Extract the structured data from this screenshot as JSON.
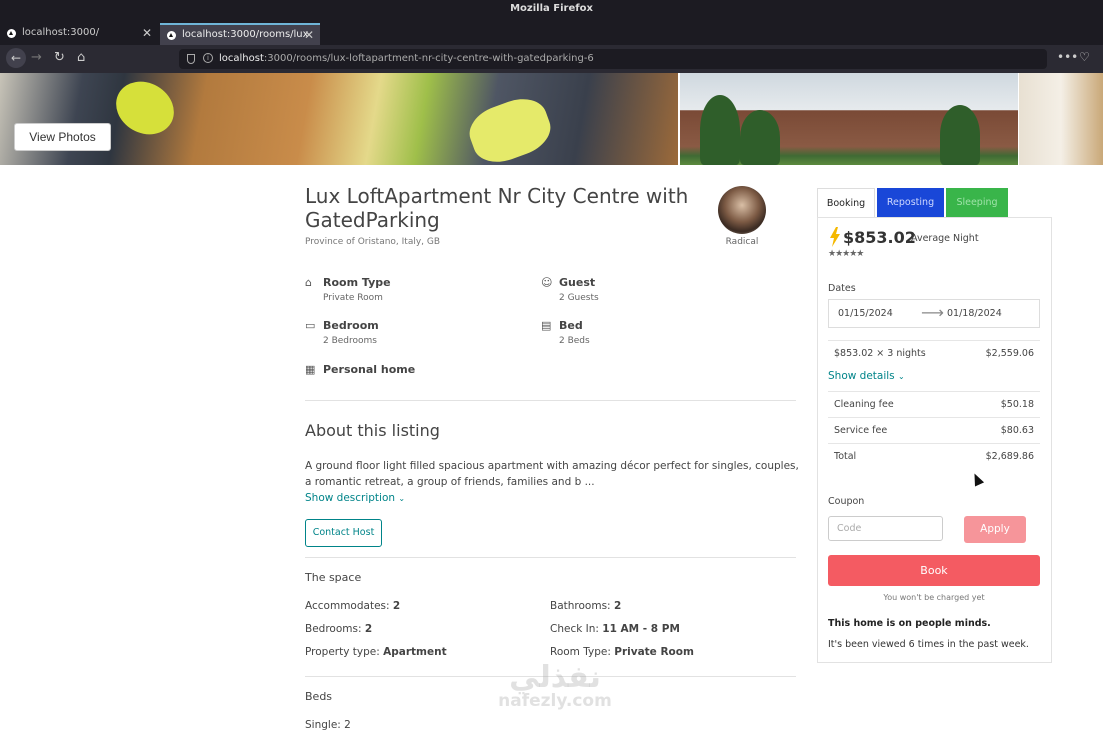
{
  "window": {
    "title": "Mozilla Firefox"
  },
  "tabs": [
    {
      "label": "localhost:3000/"
    },
    {
      "label": "localhost:3000/rooms/lux"
    }
  ],
  "url": {
    "host": "localhost",
    "rest": ":3000/rooms/lux-loftapartment-nr-city-centre-with-gatedparking-6"
  },
  "hero": {
    "view_photos": "View Photos"
  },
  "listing": {
    "title": "Lux LoftApartment Nr City Centre with GatedParking",
    "location": "Province of Oristano, Italy, GB",
    "host_name": "Radical",
    "features": [
      {
        "icon": "house-icon",
        "label": "Room Type",
        "value": "Private Room"
      },
      {
        "icon": "user-icon",
        "label": "Guest",
        "value": "2 Guests"
      },
      {
        "icon": "couch-icon",
        "label": "Bedroom",
        "value": "2 Bedrooms"
      },
      {
        "icon": "bed-icon",
        "label": "Bed",
        "value": "2 Beds"
      },
      {
        "icon": "building-icon",
        "label": "Personal home",
        "value": ""
      }
    ],
    "about_title": "About this listing",
    "description": "A ground floor light filled spacious apartment with amazing décor perfect for singles, couples, a romantic retreat, a group of friends, families and b ...",
    "show_description": "Show description",
    "contact_host": "Contact Host",
    "space_title": "The space",
    "space": [
      {
        "key": "Accommodates:",
        "value": "2"
      },
      {
        "key": "Bathrooms:",
        "value": "2"
      },
      {
        "key": "Bedrooms:",
        "value": "2"
      },
      {
        "key": "Check In:",
        "value": "11 AM - 8 PM"
      },
      {
        "key": "Property type:",
        "value": "Apartment"
      },
      {
        "key": "Room Type:",
        "value": "Private Room"
      }
    ],
    "beds_title": "Beds",
    "beds_first": "Single: 2"
  },
  "booking": {
    "tabs": [
      "Booking",
      "Reposting",
      "Sleeping"
    ],
    "price": "$853.02",
    "price_unit": "Average Night",
    "stars": "★★★★★",
    "dates_label": "Dates",
    "check_in": "01/15/2024",
    "check_out": "01/18/2024",
    "nights_label": "$853.02 × 3 nights",
    "nights_total": "$2,559.06",
    "show_details": "Show details",
    "fees": [
      {
        "label": "Cleaning fee",
        "value": "$50.18"
      },
      {
        "label": "Service fee",
        "value": "$80.63"
      },
      {
        "label": "Total",
        "value": "$2,689.86"
      }
    ],
    "coupon_label": "Coupon",
    "coupon_placeholder": "Code",
    "apply": "Apply",
    "book": "Book",
    "no_charge": "You won't be charged yet",
    "minds": "This home is on people minds.",
    "viewed": "It's been viewed 6 times in the past week."
  },
  "colors": {
    "accent": "#008489",
    "book": "#f45b62",
    "apply": "#f6959a",
    "reposting_tab": "#1947d8",
    "sleeping_tab": "#39b54a"
  },
  "watermark": {
    "ar": "نفذلي",
    "en": "nafezly.com"
  }
}
